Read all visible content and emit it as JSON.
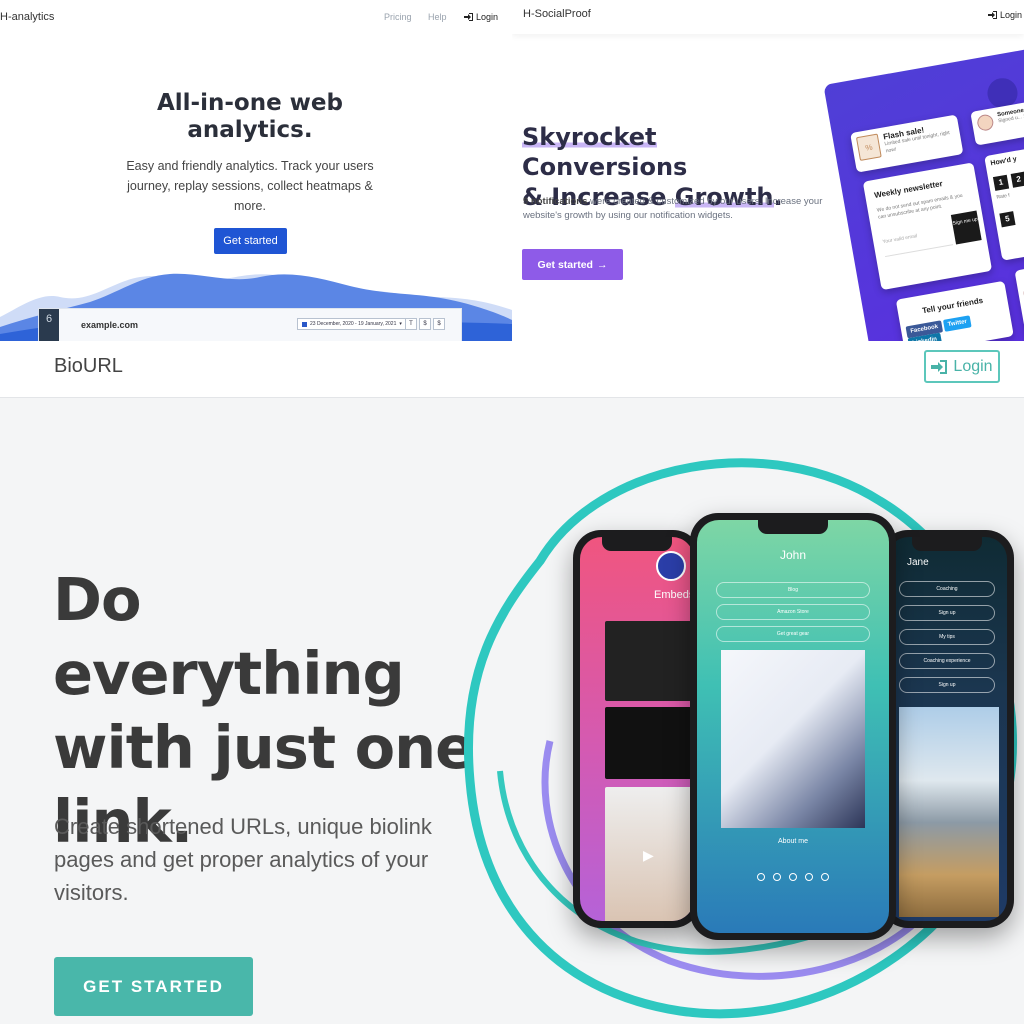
{
  "analytics": {
    "brand": "H-analytics",
    "nav": {
      "pricing": "Pricing",
      "help": "Help",
      "login": "Login"
    },
    "hero_line1": "All-in-one web",
    "hero_line2": "analytics.",
    "subtitle": "Easy and friendly analytics. Track your users journey, replay sessions, collect heatmaps & more.",
    "cta": "Get started",
    "preview": {
      "sidebar_number": "6",
      "site": "example.com",
      "date_range": "23 December, 2020 - 19 January, 2021",
      "tools": [
        "T",
        "$",
        "$"
      ]
    }
  },
  "socialproof": {
    "brand": "H-SocialProof",
    "login": "Login",
    "hero": {
      "part1": "Skyrocket",
      "part2": " Conversions",
      "part3": "& Increase ",
      "part4": "Growth",
      "part5": "."
    },
    "desc_bold": "9 notifications",
    "desc_rest": " were created & customized by our users. Increase your website's growth by using our notification widgets.",
    "cta": "Get started",
    "widgets": {
      "flash_title": "Flash sale!",
      "flash_text": "Limited sale until tonight, right now!",
      "someone_title": "Someone",
      "someone_text": "Signed u... 10 minut...",
      "newsletter_title": "Weekly newsletter",
      "newsletter_text": "We do not send out spam emails & you can unsubscribe at any point.",
      "newsletter_placeholder": "Your valid email",
      "newsletter_button": "Sign me up",
      "howd_title": "How'd y",
      "rating_numbers": [
        "1",
        "2"
      ],
      "rating_hint": "Rate f",
      "rating_five": "5",
      "friends_title": "Tell your friends",
      "share": [
        "Facebook",
        "Twitter",
        "Linkedin"
      ],
      "share_colors": [
        "#3b5998",
        "#1da1f2",
        "#0e76a8"
      ]
    }
  },
  "biourl": {
    "brand": "BioURL",
    "login": "Login",
    "headline": "Do everything with just one link.",
    "subtitle": "Create shortened URLs, unique biolink pages and get proper analytics of your visitors.",
    "cta": "GET STARTED",
    "phones": {
      "left_title": "Embeds",
      "center_name": "John",
      "center_links": [
        "Blog",
        "Amazon Store",
        "Get great gear"
      ],
      "center_about_title": "About me",
      "right_name": "Jane",
      "right_links": [
        "Coaching",
        "Sign up",
        "My tips",
        "Coaching experience",
        "Sign up"
      ]
    },
    "accent_color": "#49b7aa"
  }
}
